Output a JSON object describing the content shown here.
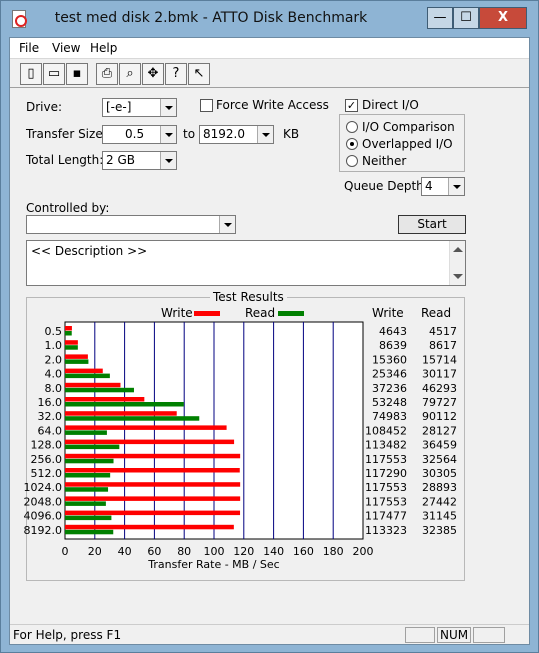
{
  "window": {
    "title": "test med disk 2.bmk - ATTO Disk Benchmark",
    "minimize_glyph": "—",
    "maximize_glyph": "☐",
    "close_glyph": "X"
  },
  "menu": {
    "file": "File",
    "view": "View",
    "help": "Help"
  },
  "toolbar": {
    "icons": [
      "new-icon",
      "open-icon",
      "save-icon",
      "print-icon",
      "print-preview-icon",
      "move-icon",
      "help-icon",
      "context-help-icon"
    ]
  },
  "settings": {
    "drive_label": "Drive:",
    "drive_value": "[-e-]",
    "force_write_label": "Force Write Access",
    "force_write_checked": false,
    "direct_io_label": "Direct I/O",
    "direct_io_checked": true,
    "transfer_size_label": "Transfer Size:",
    "transfer_from": "0.5",
    "to_label": "to",
    "transfer_to": "8192.0",
    "kb_label": "KB",
    "total_length_label": "Total Length:",
    "total_length_value": "2 GB",
    "io_comparison_label": "I/O Comparison",
    "overlapped_io_label": "Overlapped I/O",
    "neither_label": "Neither",
    "selected_io_mode": "Overlapped I/O",
    "queue_depth_label": "Queue Depth:",
    "queue_depth_value": "4",
    "controlled_by_label": "Controlled by:",
    "controlled_by_value": "",
    "start_label": "Start",
    "description_text": "<< Description >>"
  },
  "results": {
    "title": "Test Results",
    "legend_write": "Write",
    "legend_read": "Read",
    "col_write": "Write",
    "col_read": "Read"
  },
  "chart_data": {
    "type": "bar",
    "orientation": "horizontal",
    "title": "Test Results",
    "xlabel": "Transfer Rate - MB / Sec",
    "xlim": [
      0,
      200
    ],
    "xticks": [
      0,
      20,
      40,
      60,
      80,
      100,
      120,
      140,
      160,
      180,
      200
    ],
    "grid": true,
    "categories": [
      "0.5",
      "1.0",
      "2.0",
      "4.0",
      "8.0",
      "16.0",
      "32.0",
      "64.0",
      "128.0",
      "256.0",
      "512.0",
      "1024.0",
      "2048.0",
      "4096.0",
      "8192.0"
    ],
    "series": [
      {
        "name": "Write",
        "color": "#ff0000",
        "values": [
          4643,
          8639,
          15360,
          25346,
          37236,
          53248,
          74983,
          108452,
          113482,
          117553,
          117290,
          117553,
          117553,
          117477,
          113323
        ]
      },
      {
        "name": "Read",
        "color": "#008000",
        "values": [
          4517,
          8617,
          15714,
          30117,
          46293,
          79727,
          90112,
          28127,
          36459,
          32564,
          30305,
          28893,
          27442,
          31145,
          32385
        ]
      }
    ],
    "value_unit_divisor": 1000
  },
  "status": {
    "help_text": "For Help, press F1",
    "num": "NUM"
  }
}
